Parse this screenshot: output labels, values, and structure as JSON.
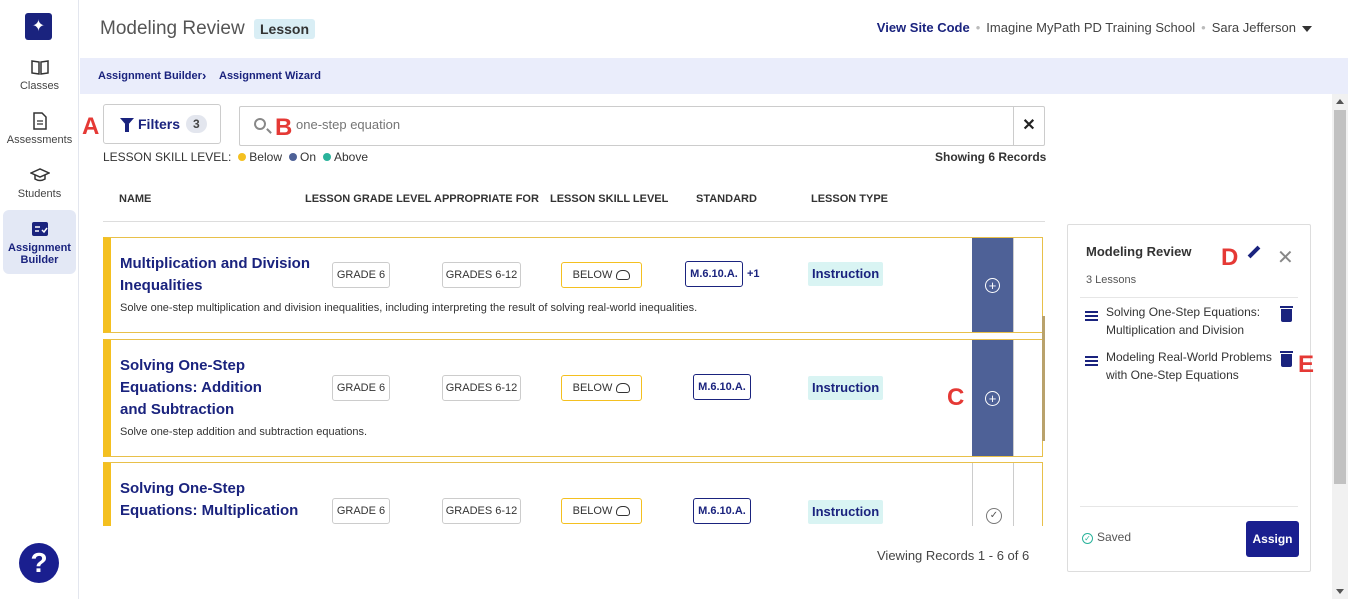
{
  "sidebar": {
    "items": [
      {
        "label": "Classes",
        "icon": "book-icon"
      },
      {
        "label": "Assessments",
        "icon": "document-icon"
      },
      {
        "label": "Students",
        "icon": "graduation-cap-icon"
      },
      {
        "label": "Assignment Builder",
        "icon": "checklist-icon"
      }
    ],
    "help_label": "?"
  },
  "header": {
    "title": "Modeling Review",
    "badge": "Lesson",
    "view_site_code": "View Site Code",
    "school": "Imagine MyPath PD Training School",
    "user": "Sara  Jefferson"
  },
  "breadcrumb": {
    "items": [
      "Assignment Builder",
      "Assignment Wizard"
    ]
  },
  "filters": {
    "label": "Filters",
    "count": "3"
  },
  "search": {
    "placeholder": "one-step equation"
  },
  "legend": {
    "prefix": "LESSON SKILL LEVEL:",
    "below": "Below",
    "on": "On",
    "above": "Above",
    "colors": {
      "below": "#f4c020",
      "on": "#4e6197",
      "above": "#2ab39b"
    }
  },
  "showing": "Showing 6 Records",
  "table": {
    "columns": [
      "NAME",
      "LESSON GRADE LEVEL",
      "APPROPRIATE FOR",
      "LESSON SKILL LEVEL",
      "STANDARD",
      "LESSON TYPE"
    ],
    "rows": [
      {
        "name": "Multiplication and Division Inequalities",
        "description": "Solve one-step multiplication and division inequalities, including interpreting the result of solving real-world inequalities.",
        "grade": "GRADE 6",
        "appropriate": "GRADES 6-12",
        "skill": "BELOW",
        "standard": "M.6.10.A.",
        "extra": "+1",
        "type": "Instruction"
      },
      {
        "name": "Solving One-Step Equations: Addition and Subtraction",
        "description": "Solve one-step addition and subtraction equations.",
        "grade": "GRADE 6",
        "appropriate": "GRADES 6-12",
        "skill": "BELOW",
        "standard": "M.6.10.A.",
        "type": "Instruction"
      },
      {
        "name": "Solving One-Step Equations: Multiplication",
        "grade": "GRADE 6",
        "appropriate": "GRADES 6-12",
        "skill": "BELOW",
        "standard": "M.6.10.A.",
        "type": "Instruction"
      }
    ]
  },
  "viewing": "Viewing Records 1 - 6 of 6",
  "panel": {
    "title": "Modeling Review",
    "subtitle": "3 Lessons",
    "items": [
      "Solving One-Step Equations: Multiplication and Division",
      "Modeling Real-World Problems with One-Step Equations"
    ],
    "saved": "Saved",
    "assign": "Assign"
  },
  "annotations": {
    "a": "A",
    "b": "B",
    "c": "C",
    "d": "D",
    "e": "E"
  }
}
